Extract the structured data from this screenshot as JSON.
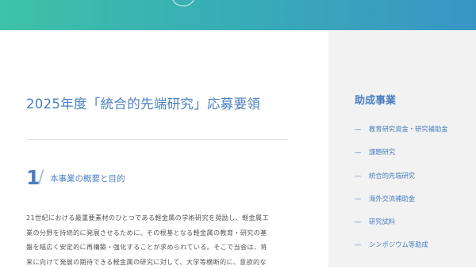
{
  "header": {
    "emblem_icon": "circle-emblem-icon",
    "gradient_colors": [
      "#3ec2a7",
      "#3a95c4"
    ]
  },
  "main": {
    "page_title": "2025年度「統合的先端研究」応募要領",
    "section": {
      "number": "1",
      "slash": "/",
      "title": "本事業の概要と目的"
    },
    "body_lines": [
      "21世紀における最重要素材のひとつである軽金属の学術研究を奨励し、軽金属工",
      "業の分野を持続的に発展させるために、その根基となる軽金属の教育・研究の基",
      "盤を幅広く安定的に再構築・強化することが求められている。そこで当会は、将",
      "来に向けて発展の期待できる軽金属の研究に対して、大学等横断的に、意欲的な"
    ]
  },
  "sidebar": {
    "heading": "助成事業",
    "dash": "—",
    "items": [
      {
        "label": "教育研究資金・研究補助金"
      },
      {
        "label": "課題研究"
      },
      {
        "label": "統合的先端研究"
      },
      {
        "label": "海外交流補助金"
      },
      {
        "label": "研究試料"
      },
      {
        "label": "シンポジウム等助成"
      }
    ]
  },
  "colors": {
    "accent": "#4a7fc1",
    "sidebar_bg": "#f2f2f2",
    "body_text": "#555555"
  }
}
